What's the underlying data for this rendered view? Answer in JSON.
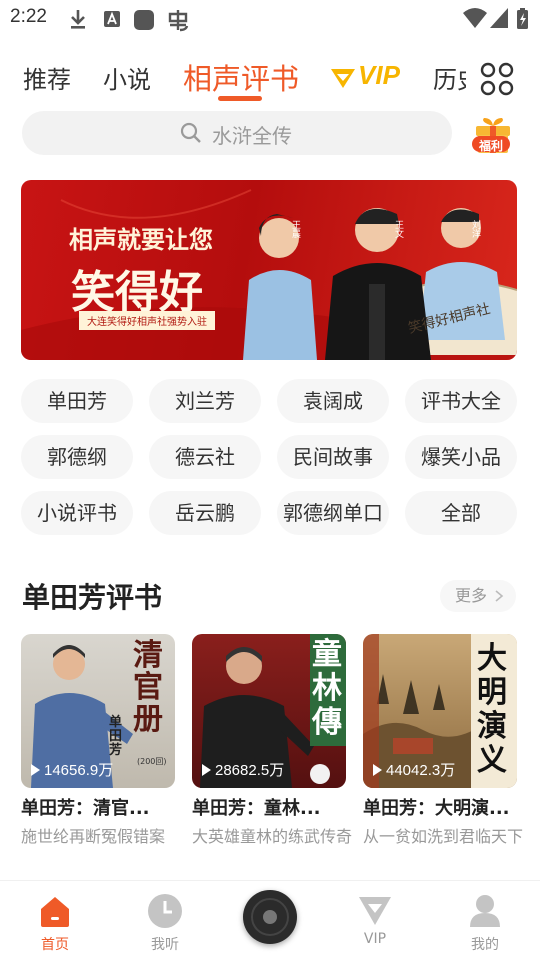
{
  "status_bar": {
    "time": "2:22"
  },
  "tabs": [
    {
      "label": "推荐"
    },
    {
      "label": "小说"
    },
    {
      "label": "相声评书"
    },
    {
      "label": "VIP"
    },
    {
      "label": "历史"
    }
  ],
  "search": {
    "placeholder": "水浒全传"
  },
  "gift": {
    "label": "福利"
  },
  "banner": {
    "headline": "相声就要让您",
    "big_text": "笑得好",
    "strip": "大连笑得好相声社强势入驻",
    "names": [
      "王晨",
      "王文",
      "刘洋"
    ],
    "fan_text": "笑得好相声社"
  },
  "tags": [
    "单田芳",
    "刘兰芳",
    "袁阔成",
    "评书大全",
    "郭德纲",
    "德云社",
    "民间故事",
    "爆笑小品",
    "小说评书",
    "岳云鹏",
    "郭德纲单口",
    "全部"
  ],
  "section": {
    "title": "单田芳评书",
    "more": "更多"
  },
  "cards": [
    {
      "title": "单田芳：清官...",
      "plays": "14656.9万",
      "desc": "施世纶再断冤假错案",
      "cover_text": "清官册",
      "author": "单田芳",
      "badge": "(200回)"
    },
    {
      "title": "单田芳：童林...",
      "plays": "28682.5万",
      "desc": "大英雄童林的练武传奇",
      "cover_text": "童林傳"
    },
    {
      "title": "单田芳：大明演...",
      "plays": "44042.3万",
      "desc": "从一贫如洗到君临天下",
      "cover_text": "大明演义"
    }
  ],
  "bottom_nav": [
    {
      "label": "首页",
      "icon": "home-icon"
    },
    {
      "label": "我听",
      "icon": "clock-icon"
    },
    {
      "label": "",
      "icon": "record-disc-icon"
    },
    {
      "label": "VIP",
      "icon": "vip-icon"
    },
    {
      "label": "我的",
      "icon": "profile-icon"
    }
  ],
  "colors": {
    "accent": "#ef5a28",
    "vip": "#f7b500",
    "banner_red": "#c81414"
  }
}
